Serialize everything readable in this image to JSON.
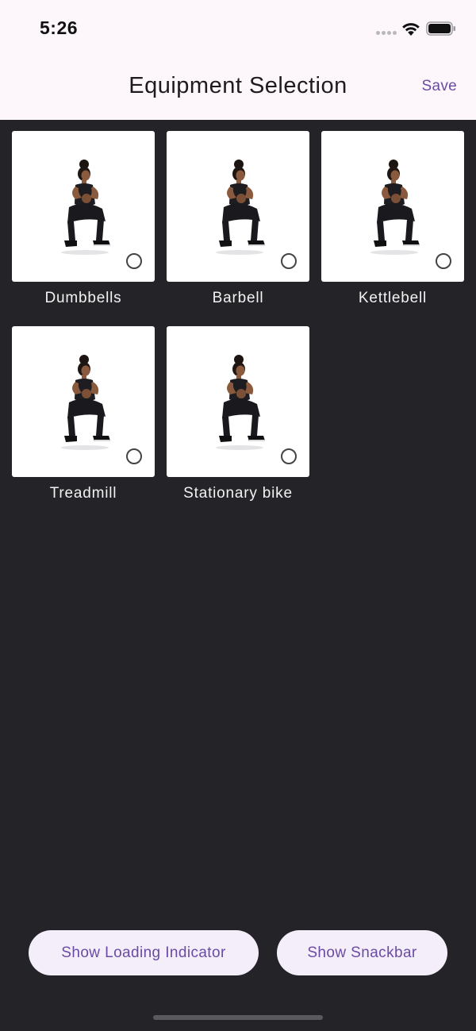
{
  "status_bar": {
    "time": "5:26",
    "icons": [
      "cellular-dots-icon",
      "wifi-icon",
      "battery-icon"
    ]
  },
  "header": {
    "title": "Equipment Selection",
    "save_label": "Save"
  },
  "equipment": {
    "items": [
      {
        "label": "Dumbbells",
        "selected": false,
        "image": "squat-woman-photo"
      },
      {
        "label": "Barbell",
        "selected": false,
        "image": "squat-woman-photo"
      },
      {
        "label": "Kettlebell",
        "selected": false,
        "image": "squat-woman-photo"
      },
      {
        "label": "Treadmill",
        "selected": false,
        "image": "squat-woman-photo"
      },
      {
        "label": "Stationary bike",
        "selected": false,
        "image": "squat-woman-photo"
      }
    ]
  },
  "actions": {
    "loading_label": "Show Loading Indicator",
    "snackbar_label": "Show Snackbar"
  },
  "colors": {
    "accent": "#6a4ba3",
    "header_bg": "#fdf7fb",
    "body_bg": "#242428",
    "button_bg": "#f4eefa"
  }
}
